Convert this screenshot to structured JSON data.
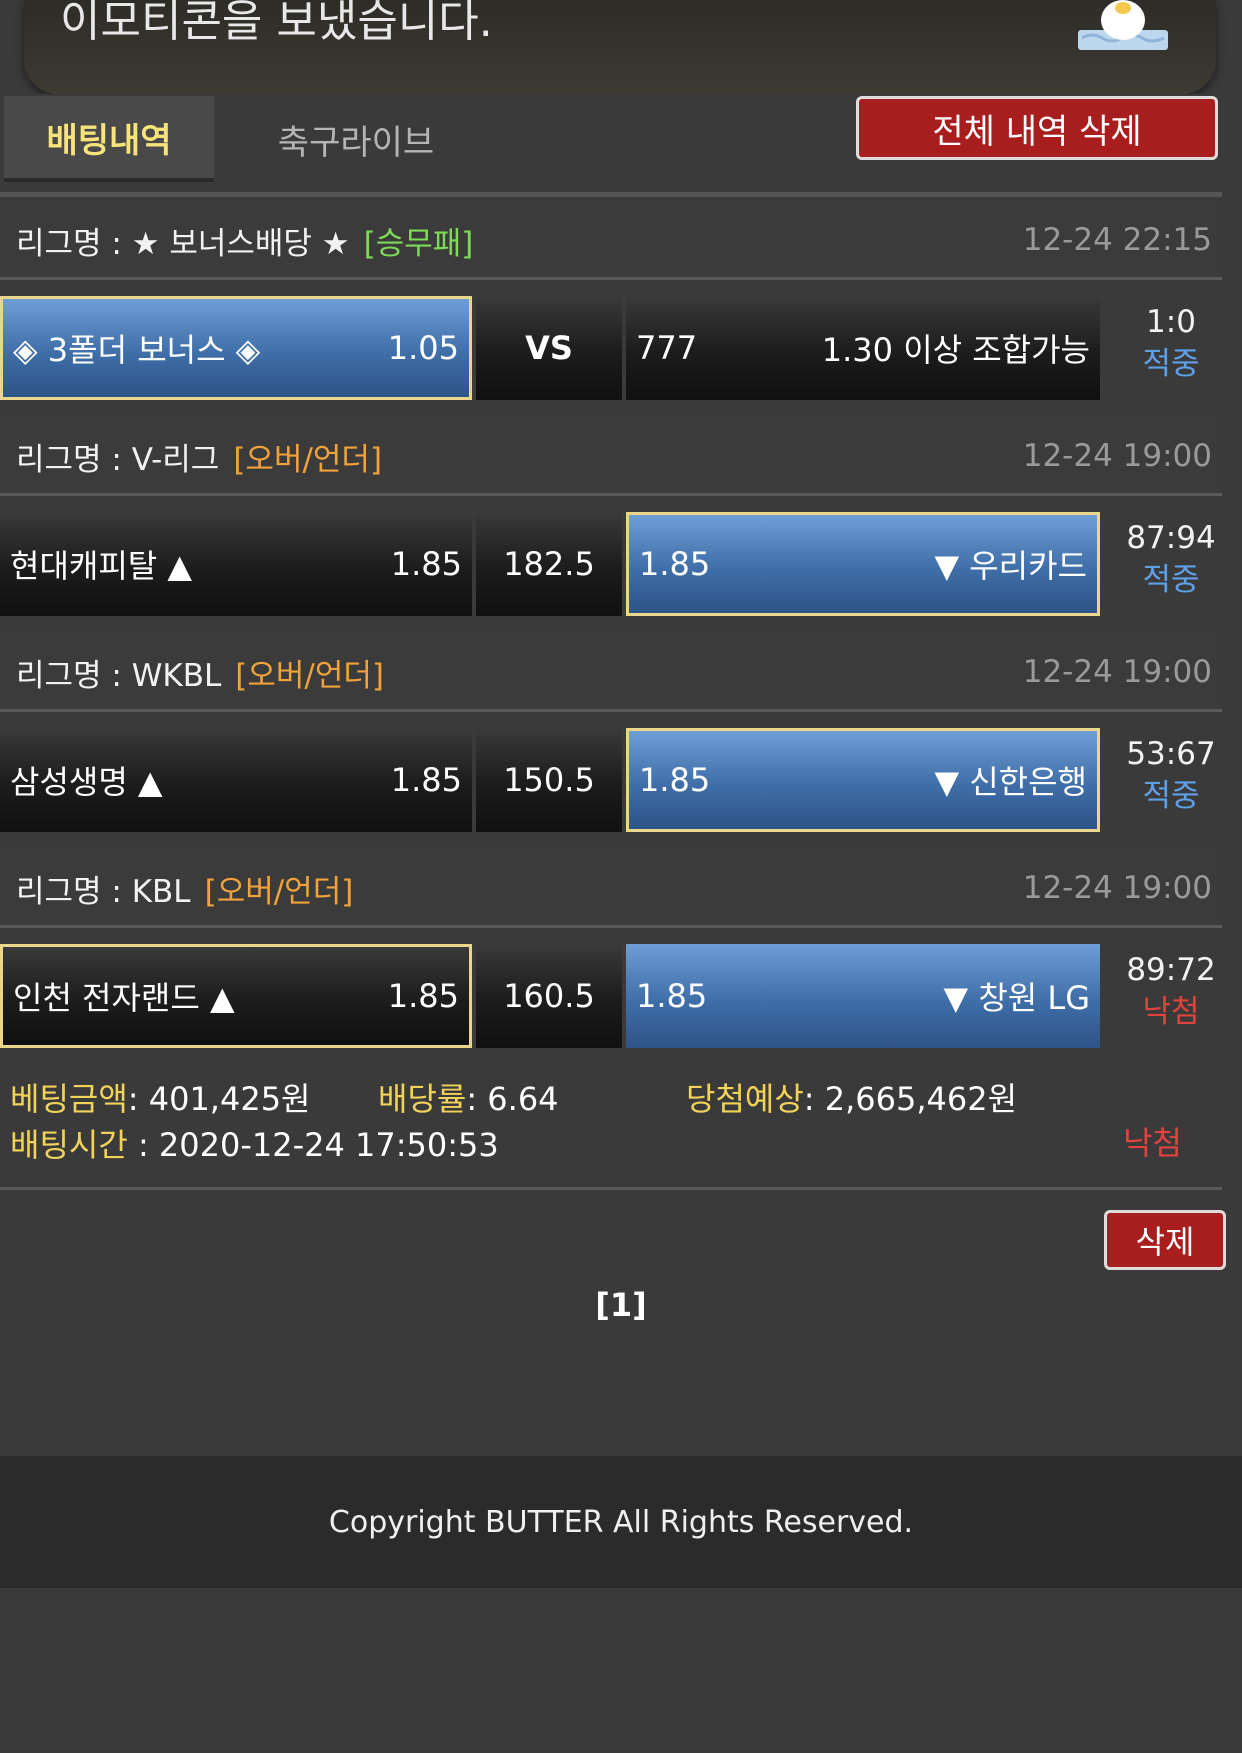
{
  "notification": {
    "text": "이모티콘을 보냈습니다."
  },
  "tabs": [
    {
      "label": "배팅내역"
    },
    {
      "label": "축구라이브"
    }
  ],
  "delete_all_label": "전체 내역 삭제",
  "bets": [
    {
      "league_prefix": "리그명 : ★ 보너스배당 ★",
      "bet_type": "[승무패]",
      "time": "12-24 22:15",
      "home": "◈ 3폴더 보너스 ◈",
      "home_odds": "1.05",
      "mid": "VS",
      "away_left": "777",
      "away_right": "1.30 이상 조합가능",
      "score": "1:0",
      "status": "적중"
    },
    {
      "league_prefix": "리그명 : V-리그",
      "bet_type": "[오버/언더]",
      "time": "12-24 19:00",
      "home": "현대캐피탈 ▲",
      "home_odds": "1.85",
      "mid": "182.5",
      "away_left": "1.85",
      "away_right": "▼ 우리카드",
      "score": "87:94",
      "status": "적중"
    },
    {
      "league_prefix": "리그명 : WKBL",
      "bet_type": "[오버/언더]",
      "time": "12-24 19:00",
      "home": "삼성생명 ▲",
      "home_odds": "1.85",
      "mid": "150.5",
      "away_left": "1.85",
      "away_right": "▼ 신한은행",
      "score": "53:67",
      "status": "적중"
    },
    {
      "league_prefix": "리그명 : KBL",
      "bet_type": "[오버/언더]",
      "time": "12-24 19:00",
      "home": "인천 전자랜드 ▲",
      "home_odds": "1.85",
      "mid": "160.5",
      "away_left": "1.85",
      "away_right": "▼ 창원 LG",
      "score": "89:72",
      "status": "낙첨"
    }
  ],
  "summary": {
    "amount_label": "베팅금액",
    "amount_value": ": 401,425원",
    "rate_label": "배당률",
    "rate_value": ": 6.64",
    "expected_label": "당첨예상",
    "expected_value": ": 2,665,462원",
    "time_label": "배팅시간",
    "time_value": " : 2020-12-24 17:50:53",
    "status": "낙첨"
  },
  "delete_label": "삭제",
  "pagination": "[1]",
  "footer": "Copyright BUTTER All Rights Reserved.",
  "colors": {
    "accent_blue": "#4a7cbc",
    "danger_red": "#a81d1d",
    "hit": "#5fa0e8",
    "miss": "#e0433d",
    "tab_active": "#f6e37a"
  }
}
